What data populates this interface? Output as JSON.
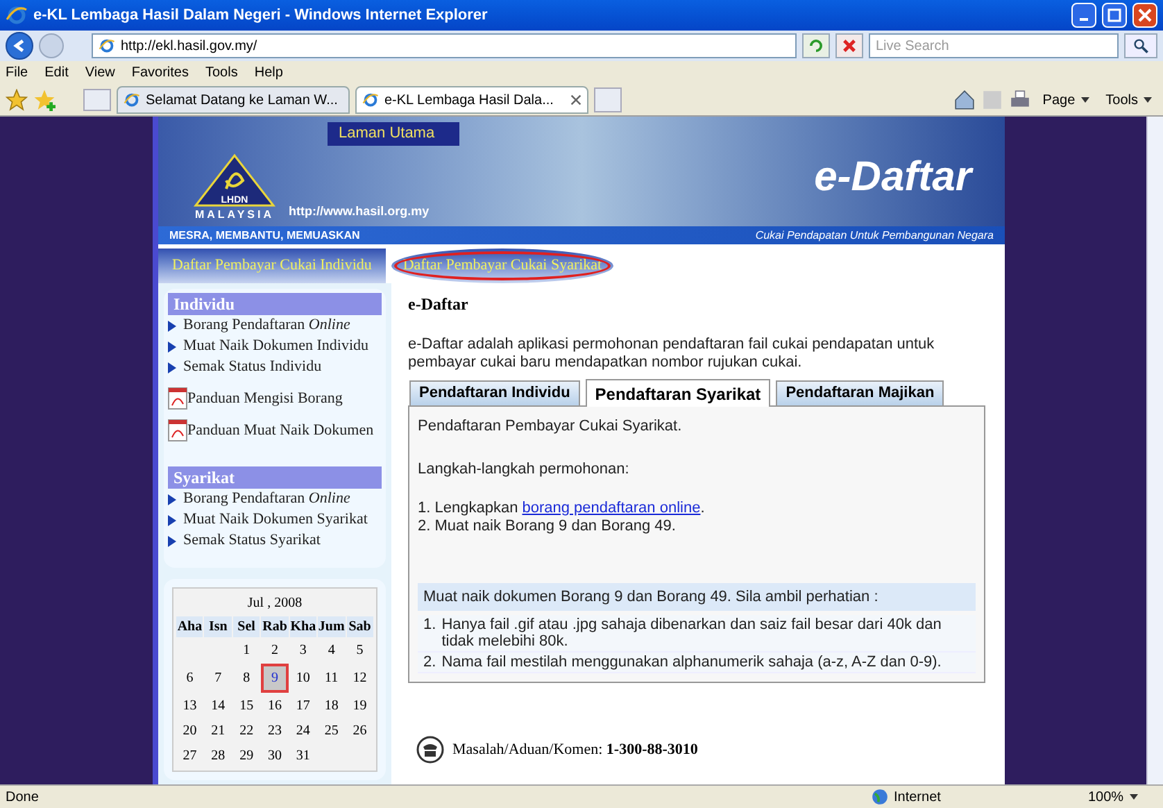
{
  "window": {
    "title": "e-KL Lembaga Hasil Dalam Negeri - Windows Internet Explorer"
  },
  "address": {
    "value": "http://ekl.hasil.gov.my/"
  },
  "search": {
    "placeholder": "Live Search"
  },
  "menu": [
    "File",
    "Edit",
    "View",
    "Favorites",
    "Tools",
    "Help"
  ],
  "browser_tabs": [
    {
      "label": "Selamat Datang ke Laman W...",
      "selected": false
    },
    {
      "label": "e-KL Lembaga Hasil Dala...",
      "selected": true
    }
  ],
  "command_bar": [
    "Page",
    "Tools"
  ],
  "banner": {
    "logo_top": "LHDN",
    "logo_bottom": "MALAYSIA",
    "home_link": "Laman Utama",
    "url": "http://www.hasil.org.my",
    "product": "e-Daftar",
    "motto": "MESRA, MEMBANTU, MEMUASKAN",
    "slogan": "Cukai Pendapatan Untuk Pembangunan Negara"
  },
  "nav_tabs": [
    {
      "label": "Daftar Pembayar Cukai Individu",
      "selected": false
    },
    {
      "label": "Daftar Pembayar Cukai Syarikat",
      "selected": true
    }
  ],
  "sidebar": [
    {
      "heading": "Individu",
      "items": [
        {
          "kind": "link",
          "text": "Borang Pendaftaran *Online*"
        },
        {
          "kind": "link",
          "text": "Muat Naik Dokumen Individu"
        },
        {
          "kind": "link",
          "text": "Semak Status Individu"
        },
        {
          "kind": "pdf",
          "text": "Panduan Mengisi Borang"
        },
        {
          "kind": "pdf",
          "text": "Panduan Muat Naik Dokumen"
        }
      ]
    },
    {
      "heading": "Syarikat",
      "items": [
        {
          "kind": "link",
          "text": "Borang Pendaftaran *Online*"
        },
        {
          "kind": "link",
          "text": "Muat Naik Dokumen Syarikat"
        },
        {
          "kind": "link",
          "text": "Semak Status Syarikat"
        }
      ]
    }
  ],
  "calendar": {
    "title": "Jul , 2008",
    "weekdays": [
      "Aha",
      "Isn",
      "Sel",
      "Rab",
      "Kha",
      "Jum",
      "Sab"
    ],
    "weeks": [
      [
        {
          "day": "1",
          "selected": false
        },
        {
          "day": "2",
          "selected": false
        },
        {
          "day": "3",
          "selected": false
        },
        {
          "day": "4",
          "selected": false
        },
        {
          "day": "5",
          "selected": false
        }
      ],
      [
        {
          "day": "6",
          "selected": false
        },
        {
          "day": "7",
          "selected": false
        },
        {
          "day": "8",
          "selected": false
        },
        {
          "day": "9",
          "selected": true
        },
        {
          "day": "10",
          "selected": false
        },
        {
          "day": "11",
          "selected": false
        },
        {
          "day": "12",
          "selected": false
        }
      ],
      [
        {
          "day": "13",
          "selected": false
        },
        {
          "day": "14",
          "selected": false
        },
        {
          "day": "15",
          "selected": false
        },
        {
          "day": "16",
          "selected": false
        },
        {
          "day": "17",
          "selected": false
        },
        {
          "day": "18",
          "selected": false
        },
        {
          "day": "19",
          "selected": false
        }
      ],
      [
        {
          "day": "20",
          "selected": false
        },
        {
          "day": "21",
          "selected": false
        },
        {
          "day": "22",
          "selected": false
        },
        {
          "day": "23",
          "selected": false
        },
        {
          "day": "24",
          "selected": false
        },
        {
          "day": "25",
          "selected": false
        },
        {
          "day": "26",
          "selected": false
        }
      ],
      [
        {
          "day": "27",
          "selected": false
        },
        {
          "day": "28",
          "selected": false
        },
        {
          "day": "29",
          "selected": false
        },
        {
          "day": "30",
          "selected": false
        },
        {
          "day": "31",
          "selected": false
        }
      ]
    ]
  },
  "main": {
    "heading": "e-Daftar",
    "intro": "e-Daftar adalah aplikasi permohonan pendaftaran fail cukai pendapatan untuk pembayar cukai baru mendapatkan nombor rujukan cukai.",
    "tabs": [
      {
        "label": "Pendaftaran Individu",
        "selected": false
      },
      {
        "label": "Pendaftaran Syarikat",
        "selected": true
      },
      {
        "label": "Pendaftaran Majikan",
        "selected": false
      }
    ],
    "panel_title": "Pendaftaran Pembayar Cukai Syarikat.",
    "steps_title": "Langkah-langkah permohonan:",
    "steps": [
      {
        "number": "1.",
        "text": "Lengkapkan ",
        "link": "borang pendaftaran online",
        "after": "."
      },
      {
        "number": "2.",
        "text": "Muat naik Borang 9 dan Borang 49."
      }
    ],
    "note_title": "Muat naik dokumen Borang 9 dan Borang 49. Sila ambil perhatian :",
    "notes": [
      {
        "number": "1.",
        "text": "Hanya fail .gif atau .jpg sahaja dibenarkan dan saiz fail besar dari 40k dan tidak melebihi 80k."
      },
      {
        "number": "2.",
        "text": "Nama fail mestilah menggunakan alphanumerik sahaja (a-z, A-Z dan 0-9)."
      }
    ],
    "contact": "Masalah/Aduan/Komen: **1-300-88-3010**"
  },
  "status_bar": {
    "status": "Done",
    "zone": "Internet",
    "zoom": "100%"
  }
}
